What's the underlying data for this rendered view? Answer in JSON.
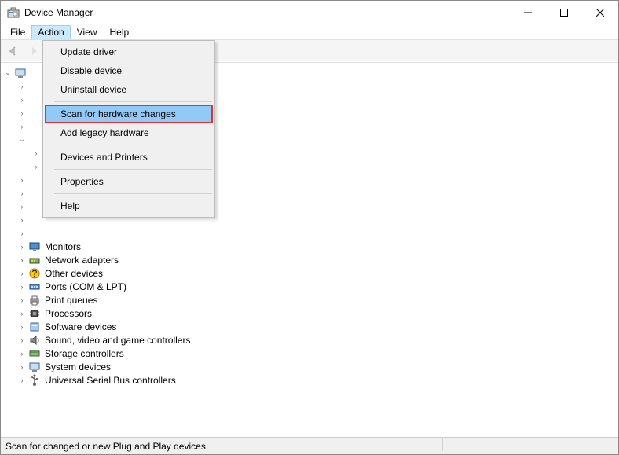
{
  "title": "Device Manager",
  "menubar": {
    "file": "File",
    "action": "Action",
    "view": "View",
    "help": "Help"
  },
  "dropdown": {
    "update": "Update driver",
    "disable": "Disable device",
    "uninstall": "Uninstall device",
    "scan": "Scan for hardware changes",
    "addlegacy": "Add legacy hardware",
    "devprint": "Devices and Printers",
    "properties": "Properties",
    "help": "Help"
  },
  "tree": {
    "items": [
      {
        "label": "Monitors"
      },
      {
        "label": "Network adapters"
      },
      {
        "label": "Other devices"
      },
      {
        "label": "Ports (COM & LPT)"
      },
      {
        "label": "Print queues"
      },
      {
        "label": "Processors"
      },
      {
        "label": "Software devices"
      },
      {
        "label": "Sound, video and game controllers"
      },
      {
        "label": "Storage controllers"
      },
      {
        "label": "System devices"
      },
      {
        "label": "Universal Serial Bus controllers"
      }
    ]
  },
  "status": "Scan for changed or new Plug and Play devices."
}
